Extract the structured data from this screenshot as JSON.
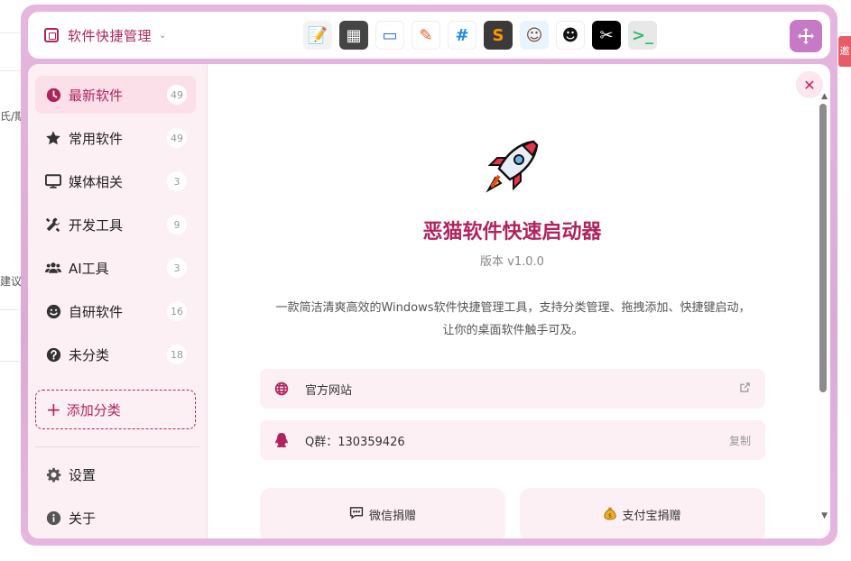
{
  "topbar": {
    "title": "软件快捷管理",
    "dock": [
      {
        "name": "notepad",
        "glyph": "📝",
        "bg": "#f3f3f3",
        "fg": "#3a7bd5"
      },
      {
        "name": "calculator",
        "glyph": "▦",
        "bg": "#444444",
        "fg": "#ffffff"
      },
      {
        "name": "window",
        "glyph": "▭",
        "bg": "#ffffff",
        "fg": "#1f6fd1"
      },
      {
        "name": "pen-tool",
        "glyph": "✎",
        "bg": "#ffffff",
        "fg": "#e85c2a"
      },
      {
        "name": "hash",
        "glyph": "#",
        "bg": "#ffffff",
        "fg": "#1e88e5"
      },
      {
        "name": "sublime",
        "glyph": "S",
        "bg": "#3a3a3a",
        "fg": "#ff9800"
      },
      {
        "name": "avatar-girl",
        "glyph": "☺",
        "bg": "#e8f4ff",
        "fg": "#7a4a2a"
      },
      {
        "name": "panda",
        "glyph": "☻",
        "bg": "#ffffff",
        "fg": "#111111"
      },
      {
        "name": "capcut",
        "glyph": "✂",
        "bg": "#000000",
        "fg": "#ffffff"
      },
      {
        "name": "chat-bot",
        "glyph": ">_",
        "bg": "#e8e8e8",
        "fg": "#2ebd6b"
      }
    ]
  },
  "sidebar": {
    "categories": [
      {
        "label": "最新软件",
        "count": "49",
        "icon": "clock-icon",
        "active": true
      },
      {
        "label": "常用软件",
        "count": "49",
        "icon": "star-icon"
      },
      {
        "label": "媒体相关",
        "count": "3",
        "icon": "monitor-icon"
      },
      {
        "label": "开发工具",
        "count": "9",
        "icon": "tools-icon"
      },
      {
        "label": "AI工具",
        "count": "3",
        "icon": "users-icon"
      },
      {
        "label": "自研软件",
        "count": "16",
        "icon": "smile-icon"
      },
      {
        "label": "未分类",
        "count": "18",
        "icon": "question-icon"
      }
    ],
    "add_label": "添加分类",
    "settings_label": "设置",
    "about_label": "关于"
  },
  "about": {
    "app_name": "恶猫软件快速启动器",
    "version": "版本 v1.0.0",
    "description": "一款简洁清爽高效的Windows软件快捷管理工具，支持分类管理、拖拽添加、快捷键启动，让你的桌面软件触手可及。",
    "website_label": "官方网站",
    "qq_label": "Q群：130359426",
    "copy_label": "复制",
    "wechat_donate": "微信捐赠",
    "alipay_donate": "支付宝捐赠"
  },
  "background": {
    "side_text_1": "氏/期",
    "side_text_2": "建议_",
    "badge": "邀"
  },
  "colors": {
    "accent": "#b0245e",
    "frame": "#dcaad4",
    "sidebar_bg": "#fdf0f5",
    "active_bg": "#fbe0ea"
  }
}
